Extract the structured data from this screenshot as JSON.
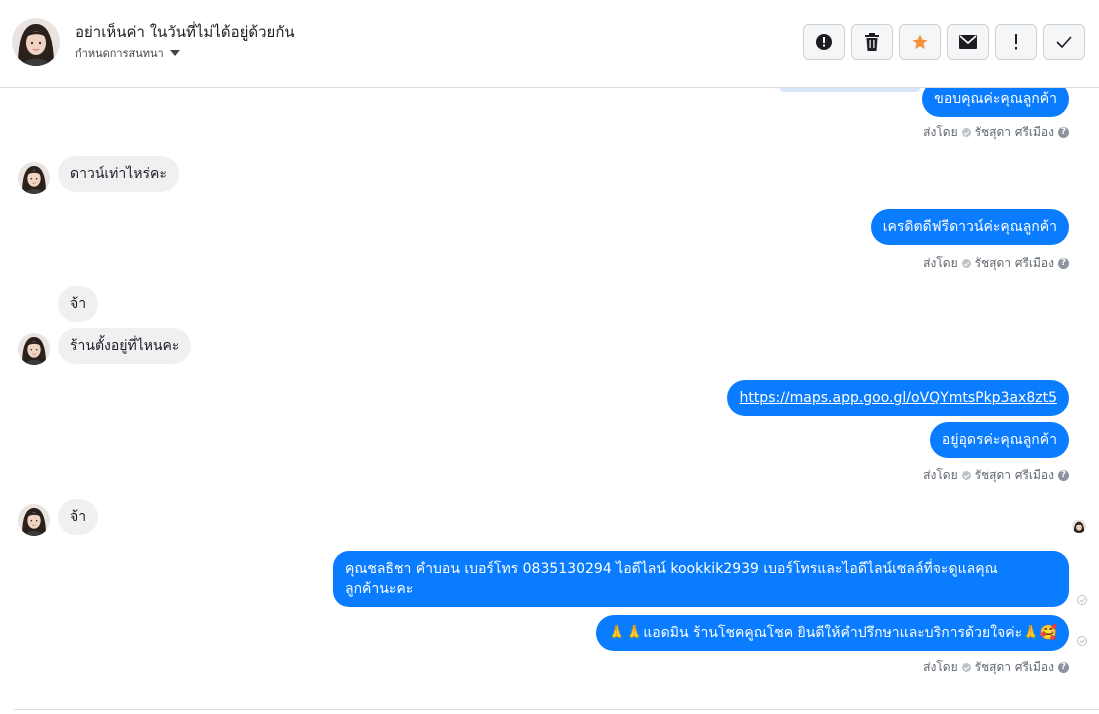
{
  "header": {
    "name": "อย่าเห็นค่า ในวันที่ไม่ได้อยู่ด้วยกัน",
    "subtitle": "กำหนดการสนทนา"
  },
  "toolbar": [
    {
      "icon": "alert-icon"
    },
    {
      "icon": "trash-icon"
    },
    {
      "icon": "star-icon",
      "color": "#f7923b"
    },
    {
      "icon": "mail-icon"
    },
    {
      "icon": "exclamation-icon"
    },
    {
      "icon": "check-icon"
    }
  ],
  "sender_meta": {
    "sent_by": "ส่งโดย",
    "agent": "รัชสุดา ศรีเมือง"
  },
  "messages": {
    "m1": "ขอบคุณค่ะคุณลูกค้า",
    "m2": "ดาวน์เท่าไหร่คะ",
    "m3": "เครดิตดีฟรีดาวน์ค่ะคุณลูกค้า",
    "m4": "จ้า",
    "m5": "ร้านตั้งอยู่ที่ไหนคะ",
    "m6": "https://maps.app.goo.gl/oVQYmtsPkp3ax8zt5",
    "m7": "อยู่อุดรค่ะคุณลูกค้า",
    "m8": "จ้า",
    "m9_line1": "คุณชลธิชา คำบอน เบอร์โทร 0835130294  ไอดีไลน์ kookkik2939  เบอร์โทรและไอดีไลน์เซลล์ที่จะดูแลคุณ",
    "m9_line2": "ลูกค้านะคะ",
    "m10": "🙏🙏แอดมิน ร้านโชคคูณโชค ยินดีให้คำปรึกษาและบริการด้วยใจค่ะ🙏🥰"
  },
  "colors": {
    "outgoing": "#0a7cff",
    "incoming": "#eff0f2"
  }
}
